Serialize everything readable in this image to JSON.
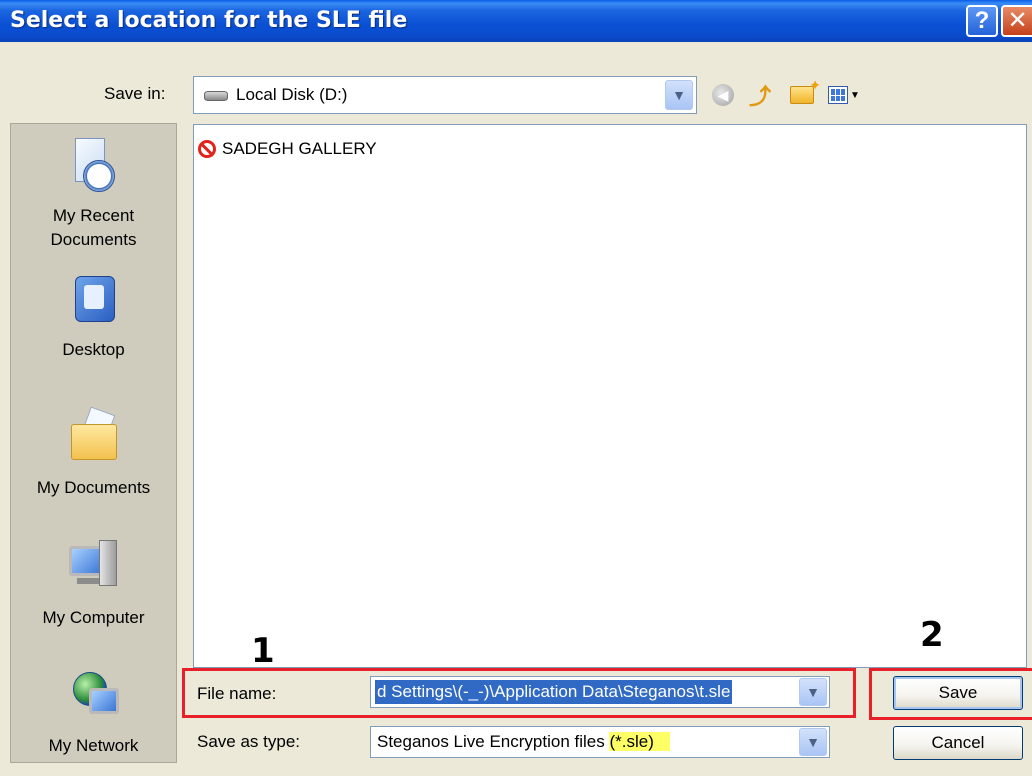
{
  "window": {
    "title": "Select a location for the SLE file",
    "help_label": "?",
    "close_label": "✕"
  },
  "save_in": {
    "label": "Save in:",
    "value": "Local Disk (D:)"
  },
  "toolbar": {
    "icons": [
      "back-icon",
      "up-folder-icon",
      "new-folder-icon",
      "views-menu-icon"
    ]
  },
  "places": [
    {
      "label_line1": "My Recent",
      "label_line2": "Documents",
      "icon": "recent-documents-icon"
    },
    {
      "label_line1": "Desktop",
      "label_line2": "",
      "icon": "desktop-icon"
    },
    {
      "label_line1": "My Documents",
      "label_line2": "",
      "icon": "my-documents-icon"
    },
    {
      "label_line1": "My Computer",
      "label_line2": "",
      "icon": "my-computer-icon"
    },
    {
      "label_line1": "My Network",
      "label_line2": "",
      "icon": "my-network-icon"
    }
  ],
  "files": [
    {
      "name": "SADEGH GALLERY",
      "icon": "no-access-icon"
    }
  ],
  "file_name": {
    "label": "File name:",
    "value": "d Settings\\(-_-)\\Application Data\\Steganos\\t.sle"
  },
  "save_as_type": {
    "label": "Save as type:",
    "value_main": "Steganos Live Encryption files ",
    "value_highlight": "(*.sle)"
  },
  "buttons": {
    "save": "Save",
    "cancel": "Cancel"
  },
  "annotations": {
    "step1": "1",
    "step2": "2",
    "box_color": "#e8202a",
    "highlight_color": "#ffff66"
  },
  "colors": {
    "titlebar": "#0a4fd4",
    "dialog_bg": "#ece9d8",
    "selection": "#316ac5"
  }
}
